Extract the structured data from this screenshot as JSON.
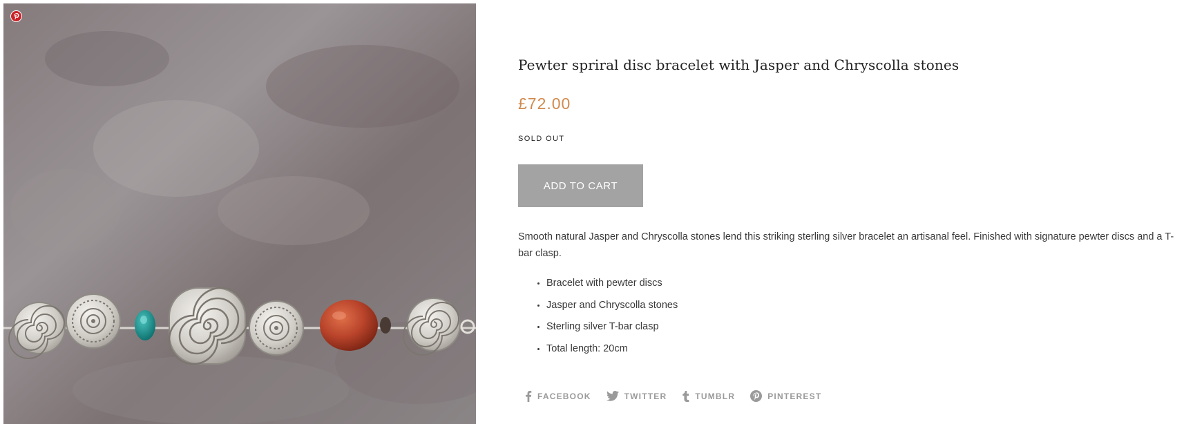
{
  "product": {
    "title": "Pewter spriral disc bracelet with Jasper and Chryscolla stones",
    "price": "£72.00",
    "status": "SOLD OUT",
    "add_to_cart_label": "ADD TO CART",
    "description": "Smooth natural Jasper and Chryscolla stones lend this striking sterling silver bracelet an artisanal feel. Finished with signature pewter discs and a T-bar clasp.",
    "features": [
      "Bracelet with pewter discs",
      "Jasper and Chryscolla stones",
      "Sterling silver T-bar clasp",
      "Total length: 20cm"
    ]
  },
  "image": {
    "pin_icon": "pinterest-icon"
  },
  "share": {
    "facebook": {
      "label": "FACEBOOK",
      "icon": "facebook-icon"
    },
    "twitter": {
      "label": "TWITTER",
      "icon": "twitter-icon"
    },
    "tumblr": {
      "label": "TUMBLR",
      "icon": "tumblr-icon"
    },
    "pinterest": {
      "label": "PINTEREST",
      "icon": "pinterest-icon"
    }
  },
  "colors": {
    "price": "#d08a4e",
    "button_bg": "#a3a3a3",
    "share_text": "#9a9a9a",
    "pinterest_red": "#cb2027"
  }
}
